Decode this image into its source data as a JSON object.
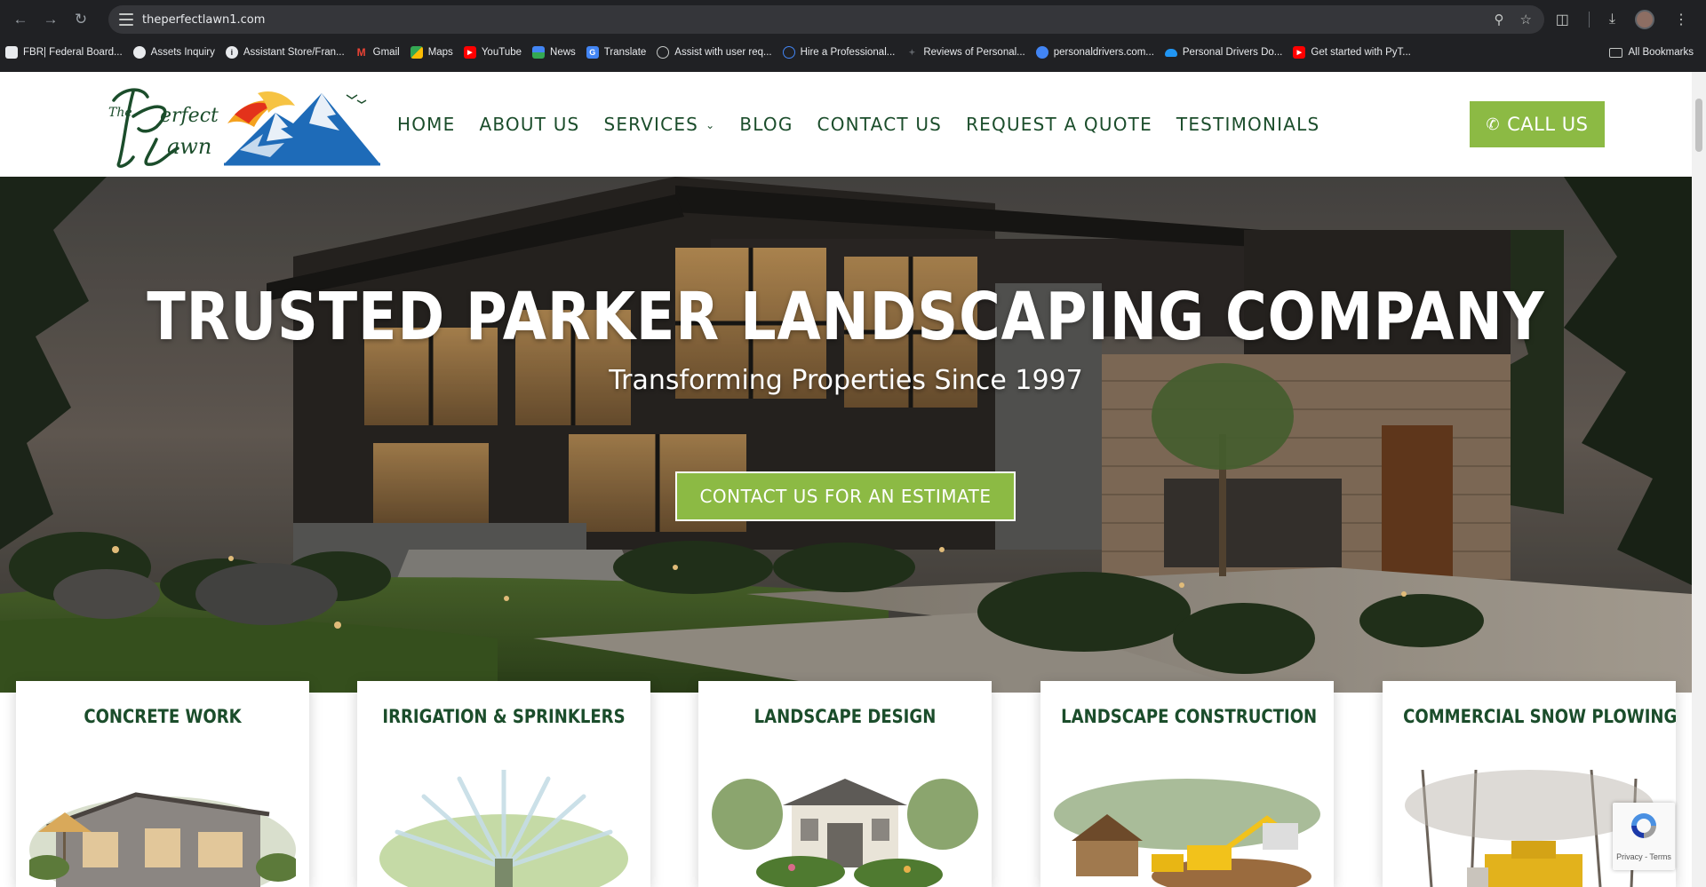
{
  "browser": {
    "url": "theperfectlawn1.com",
    "bookmarks": [
      {
        "label": "FBR| Federal Board...",
        "icon": "document-icon",
        "color": "#e8eaed"
      },
      {
        "label": "Assets Inquiry",
        "icon": "globe-icon",
        "color": "#e8eaed"
      },
      {
        "label": "Assistant Store/Fran...",
        "icon": "info-icon",
        "color": "#e8eaed"
      },
      {
        "label": "Gmail",
        "icon": "gmail-icon",
        "color": "#ea4335"
      },
      {
        "label": "Maps",
        "icon": "maps-icon",
        "color": "#34a853"
      },
      {
        "label": "YouTube",
        "icon": "youtube-icon",
        "color": "#ff0000"
      },
      {
        "label": "News",
        "icon": "news-icon",
        "color": "#4285f4"
      },
      {
        "label": "Translate",
        "icon": "translate-icon",
        "color": "#4285f4"
      },
      {
        "label": "Assist with user req...",
        "icon": "openai-icon",
        "color": "#9aa0a6"
      },
      {
        "label": "Hire a Professional...",
        "icon": "globe-icon",
        "color": "#4285f4"
      },
      {
        "label": "Reviews of Personal...",
        "icon": "sparkle-icon",
        "color": "#5f6368"
      },
      {
        "label": "personaldrivers.com...",
        "icon": "globe-icon",
        "color": "#4285f4"
      },
      {
        "label": "Personal Drivers Do...",
        "icon": "cloud-icon",
        "color": "#2196f3"
      },
      {
        "label": "Get started with PyT...",
        "icon": "youtube-icon",
        "color": "#ff0000"
      }
    ],
    "all_bookmarks": "All Bookmarks"
  },
  "site": {
    "logo_alt": "The Perfect Lawn",
    "nav": [
      {
        "label": "HOME"
      },
      {
        "label": "ABOUT US"
      },
      {
        "label": "SERVICES",
        "has_dropdown": true
      },
      {
        "label": "BLOG"
      },
      {
        "label": "CONTACT US"
      },
      {
        "label": "REQUEST A QUOTE"
      },
      {
        "label": "TESTIMONIALS"
      }
    ],
    "call_button": "CALL US",
    "hero": {
      "title": "TRUSTED PARKER LANDSCAPING COMPANY",
      "subtitle": "Transforming Properties Since 1997",
      "cta": "CONTACT US FOR AN ESTIMATE"
    },
    "services": [
      {
        "title": "CONCRETE WORK"
      },
      {
        "title": "IRRIGATION & SPRINKLERS"
      },
      {
        "title": "LANDSCAPE DESIGN"
      },
      {
        "title": "LANDSCAPE CONSTRUCTION"
      },
      {
        "title": "COMMERCIAL SNOW PLOWING"
      }
    ],
    "recaptcha": "Privacy - Terms"
  },
  "colors": {
    "brand_green": "#1b4d2b",
    "accent_green": "#8cba44",
    "chrome_bg": "#202124"
  }
}
